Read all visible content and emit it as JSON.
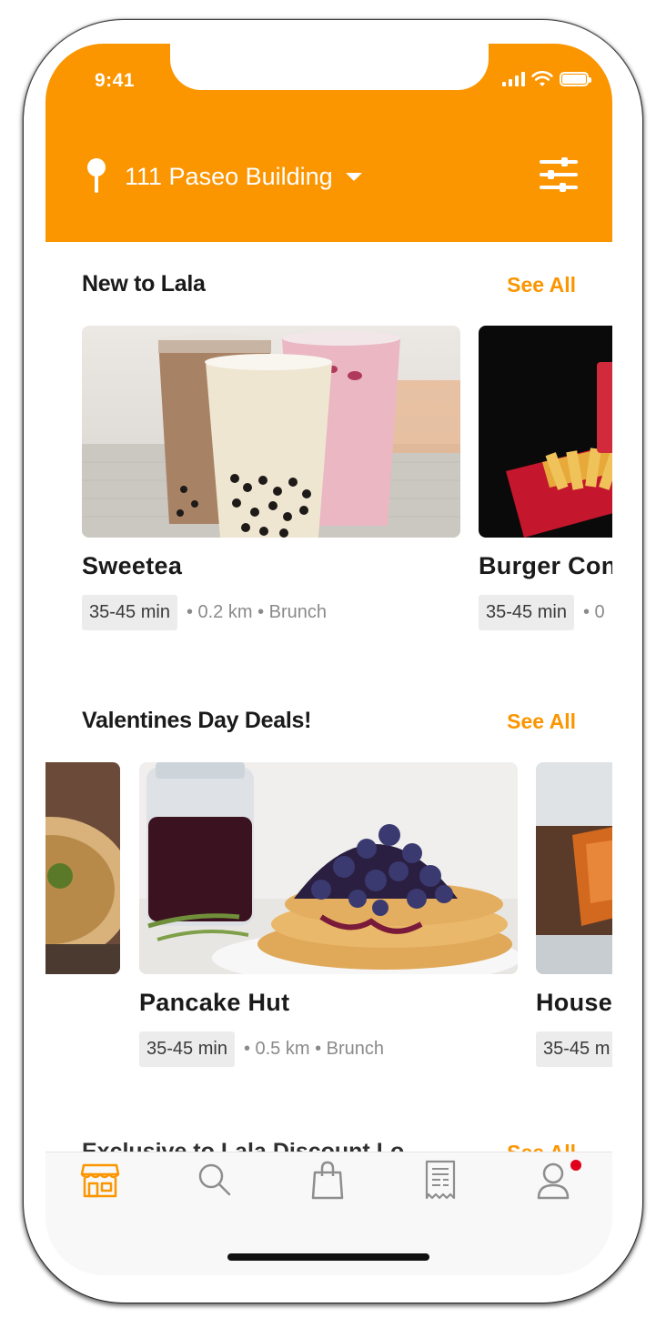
{
  "status_bar": {
    "time": "9:41"
  },
  "header": {
    "location": "111 Paseo Building"
  },
  "sections": [
    {
      "title": "New to Lala",
      "see_all": "See All",
      "cards": [
        {
          "name": "Sweetea",
          "time": "35-45 min",
          "meta": "• 0.2 km • Brunch"
        },
        {
          "name": "Burger Con",
          "time": "35-45 min",
          "meta": "• 0"
        }
      ]
    },
    {
      "title": "Valentines Day Deals!",
      "see_all": "See All",
      "cards": [
        {
          "name": "Pancake Hut",
          "time": "35-45 min",
          "meta": "• 0.5 km • Brunch"
        },
        {
          "name": "House",
          "time": "35-45 m",
          "meta": ""
        }
      ]
    }
  ],
  "peek_section": {
    "title": "Exclusive to Lala Discount Lo",
    "see_all": "See All"
  },
  "tabbar": {
    "items": [
      "store-icon",
      "search-icon",
      "bag-icon",
      "receipt-icon",
      "profile-icon"
    ],
    "active_color": "#fb9500",
    "inactive_color": "#8e8e8e",
    "notification_color": "#e0001b"
  },
  "colors": {
    "accent": "#fb9500"
  }
}
